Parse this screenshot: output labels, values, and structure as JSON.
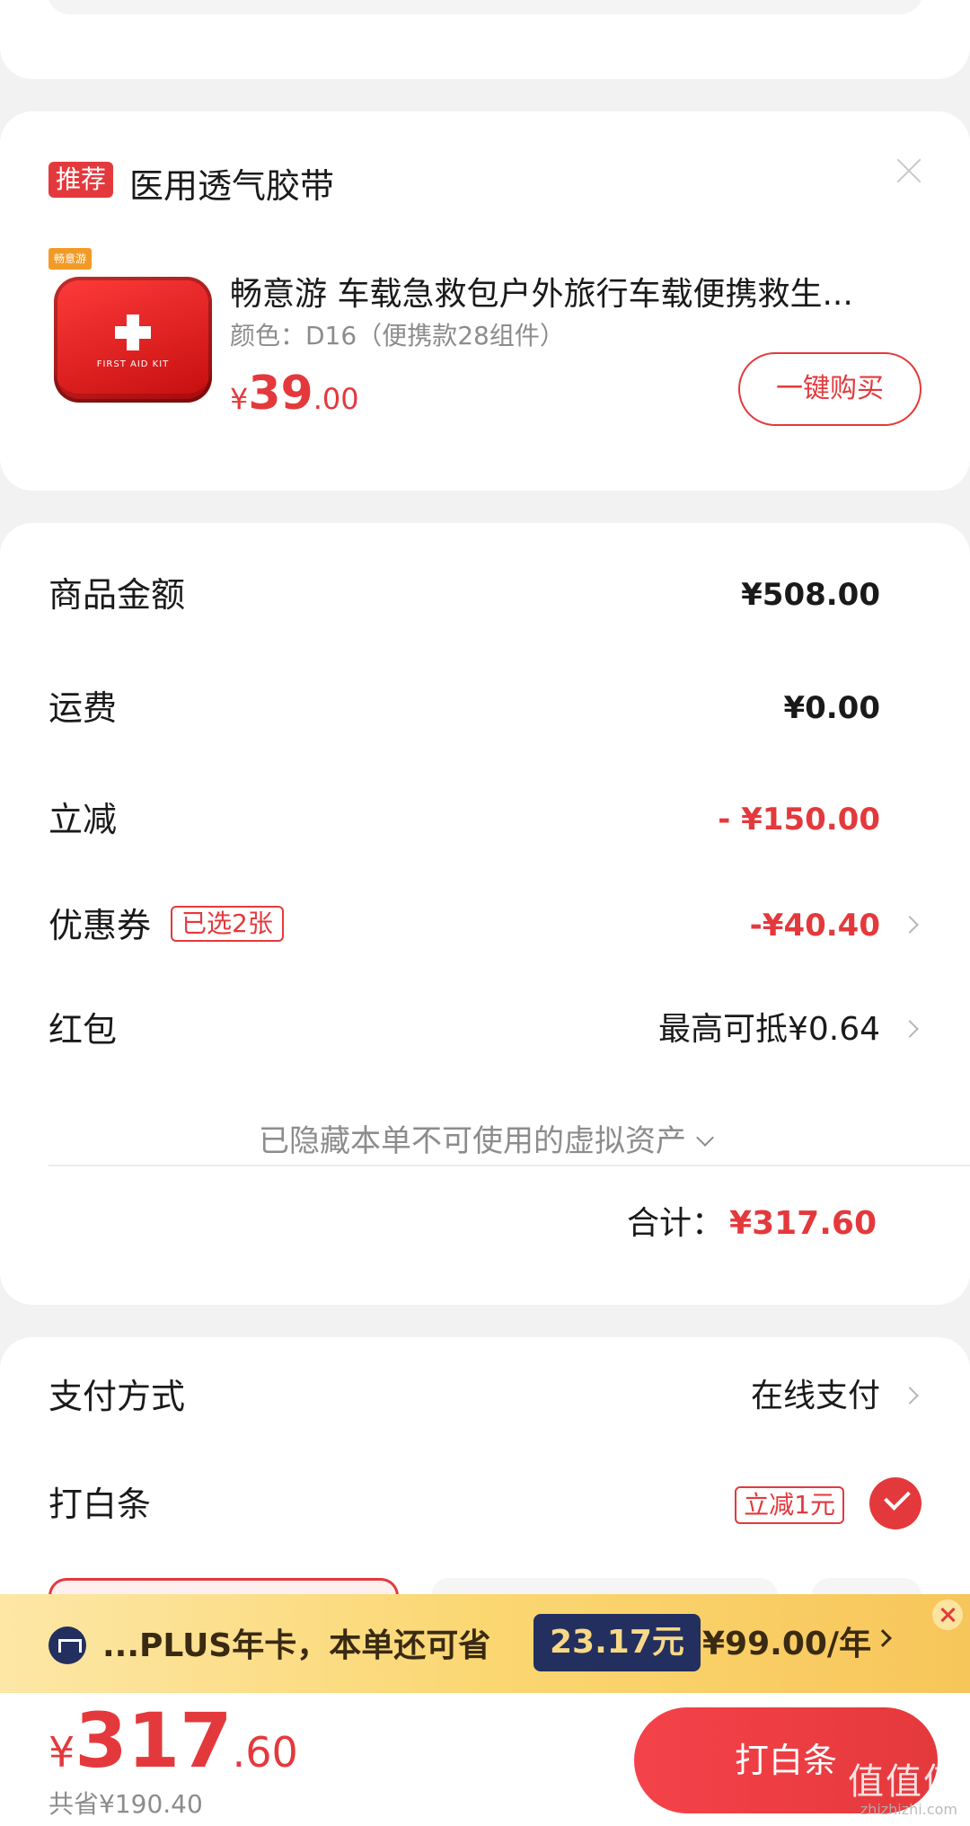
{
  "recommend": {
    "tag": "推荐",
    "title": "医用透气胶带",
    "product": {
      "brand_chip": "畅意游",
      "image_text": "FIRST AID KIT",
      "name": "畅意游 车载急救包户外旅行车载便携救生...",
      "spec": "颜色：D16（便携款28组件）",
      "price_symbol": "¥",
      "price_int": "39",
      "price_dec": ".00"
    },
    "buy_button": "一键购买"
  },
  "summary": {
    "goods_label": "商品金额",
    "goods_value": "¥508.00",
    "shipping_label": "运费",
    "shipping_value": "¥0.00",
    "discount_label": "立减",
    "discount_value": "- ¥150.00",
    "coupon_label": "优惠券",
    "coupon_badge": "已选2张",
    "coupon_value": "-¥40.40",
    "redpacket_label": "红包",
    "redpacket_value": "最高可抵¥0.64",
    "hidden_note": "已隐藏本单不可使用的虚拟资产",
    "total_label": "合计：",
    "total_value": "¥317.60"
  },
  "payment": {
    "method_label": "支付方式",
    "method_value": "在线支付",
    "baitiao_label": "打白条",
    "baitiao_tag": "立减1元"
  },
  "plus_bar": {
    "text": "...PLUS年卡，本单还可省",
    "save": "23.17元",
    "price": "¥99.00/年"
  },
  "bottom": {
    "price_symbol": "¥",
    "price_int": "317",
    "price_dec": ".60",
    "saved": "共省¥190.40",
    "submit": "打白条",
    "watermark": "值值值",
    "watermark_sub": "zhizhizhi.com"
  },
  "colors": {
    "accent": "#e4393c",
    "plus_dark": "#232f5e",
    "plus_gold": "#fbd772"
  }
}
